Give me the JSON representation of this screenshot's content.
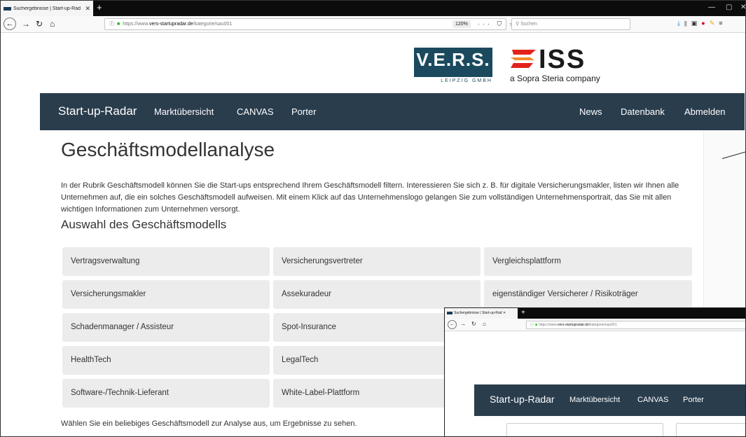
{
  "browser": {
    "tab_title": "Suchergebnisse | Start-up-Rad",
    "tab_close": "✕",
    "new_tab": "+",
    "window_controls": [
      "—",
      "▢",
      "✕"
    ],
    "url_prefix": "https://www.",
    "url_host": "vers-startupradar.de",
    "url_path": "/kategorie/sau001",
    "zoom": "120%",
    "page_actions": "··· ⛉ ☆",
    "search_placeholder": "Suchen",
    "toolbar_icons": {
      "download": "⤓",
      "library": "⫴",
      "sidebar": "▣",
      "ublock": "●",
      "ext": "✎",
      "menu": "≡"
    }
  },
  "logos": {
    "vers_text": "V.E.R.S.",
    "vers_sub": "LEIPZIG GMBH",
    "iss_text": "ISS",
    "iss_tag": "a Sopra Steria company"
  },
  "sitenav": {
    "brand": "Start-up-Radar",
    "left_items": [
      "Marktübersicht",
      "CANVAS",
      "Porter"
    ],
    "right_items": [
      "News",
      "Datenbank",
      "Abmelden"
    ]
  },
  "page": {
    "title": "Geschäftsmodellanalyse",
    "intro": "In der Rubrik Geschäftsmodell können Sie die Start-ups entsprechend Ihrem Geschäftsmodell filtern. Interessieren Sie sich z. B. für digitale Versicherungsmakler, listen wir Ihnen alle Unternehmen auf, die ein solches Geschäftsmodell aufweisen. Mit einem Klick auf das Unternehmenslogo gelangen Sie zum vollständigen Unternehmensportrait, das Sie mit allen wichtigen Informationen zum Unternehmen versorgt.",
    "subtitle": "Auswahl des Geschäftsmodells",
    "models": [
      "Vertragsverwaltung",
      "Versicherungsvertreter",
      "Vergleichsplattform",
      "Versicherungsmakler",
      "Assekuradeur",
      "eigenständiger Versicherer / Risikoträger",
      "Schadenmanager / Assisteur",
      "Spot-Insurance",
      "HealthTech",
      "LegalTech",
      "Software-/Technik-Lieferant",
      "White-Label-Plattform"
    ],
    "hint": "Wählen Sie ein beliebiges Geschäftsmodell zur Analyse aus, um Ergebnisse zu sehen."
  },
  "overlay": {
    "tab_title": "Suchergebnisse | Start-up-Rad",
    "tab_close": "✕",
    "new_tab": "+",
    "url_prefix": "https://www.",
    "url_host": "vers-startupradar.de",
    "url_path": "/kategorie/sau001",
    "brand": "Start-up-Radar",
    "items": [
      "Marktübersicht",
      "CANVAS",
      "Porter"
    ]
  },
  "colors": {
    "nav_bg": "#2a3d4d",
    "vers_blue": "#1b4a5e",
    "iss_red": "#e2231a",
    "cell_bg": "#ececec"
  }
}
